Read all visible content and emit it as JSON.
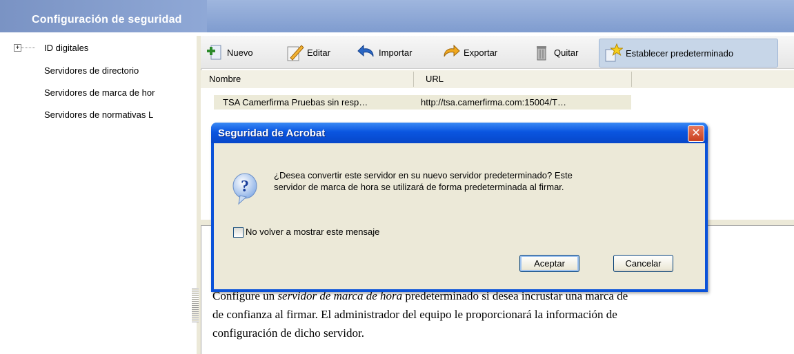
{
  "window": {
    "title": "Configuración de seguridad"
  },
  "tree": {
    "expander_symbol": "+",
    "items": [
      {
        "label": "ID digitales"
      },
      {
        "label": "Servidores de directorio"
      },
      {
        "label": "Servidores de marca de hor"
      },
      {
        "label": "Servidores de normativas L"
      }
    ]
  },
  "toolbar": {
    "buttons": [
      {
        "label": "Nuevo",
        "icon": "new-icon"
      },
      {
        "label": "Editar",
        "icon": "edit-icon"
      },
      {
        "label": "Importar",
        "icon": "import-icon"
      },
      {
        "label": "Exportar",
        "icon": "export-icon"
      },
      {
        "label": "Quitar",
        "icon": "trash-icon"
      },
      {
        "label": "Establecer predeterminado",
        "icon": "star-icon"
      }
    ]
  },
  "table": {
    "columns": [
      "Nombre",
      "URL"
    ],
    "rows": [
      {
        "name": "TSA Camerfirma Pruebas sin resp…",
        "url": "http://tsa.camerfirma.com:15004/T…"
      }
    ]
  },
  "description": {
    "line1_a": "Configure un ",
    "line1_italic": "servidor de marca de hora",
    "line1_b": " predeterminado si desea incrustar una marca de",
    "line2": "de confianza al firmar. El administrador del equipo le proporcionará la información de",
    "line3": "configuración de dicho servidor."
  },
  "dialog": {
    "title": "Seguridad de Acrobat",
    "close_symbol": "✕",
    "message_line1": "¿Desea convertir este servidor en su nuevo servidor predeterminado? Este",
    "message_line2": "servidor de marca de hora se utilizará de forma predeterminada al firmar.",
    "checkbox_label": "No volver a mostrar este mensaje",
    "checkbox_checked": false,
    "ok_label": "Aceptar",
    "cancel_label": "Cancelar"
  },
  "colors": {
    "titlebar": "#8fa8d6",
    "dialog_title": "#0a55e0",
    "dialog_body": "#ece9d8",
    "row_highlight": "#ecead8"
  }
}
